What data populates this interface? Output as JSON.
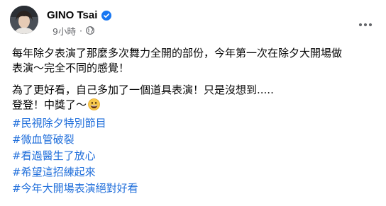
{
  "post": {
    "author": "GINO Tsai",
    "timestamp": "9小時",
    "separator": "·",
    "paragraphs": [
      {
        "lines": [
          "每年除夕表演了那麼多次舞力全開的部份，今年第一次在除夕大開場做",
          "表演～完全不同的感覺！"
        ]
      },
      {
        "lines": [
          "為了更好看，自己多加了一個道具表演！只是沒想到.....",
          "登登！中獎了～"
        ]
      }
    ],
    "hashtags": [
      "#民視除夕特別節目",
      "#微血管破裂",
      "#看過醫生了放心",
      "#希望這招練起來",
      "#今年大開場表演絕對好看"
    ],
    "icons": {
      "verified": "verified-badge-icon",
      "audience": "globe-icon",
      "more": "more-options-icon",
      "emoji": "grinning-face-emoji"
    },
    "colors": {
      "hashtag": "#216fdb",
      "verified": "#1877f2",
      "meta": "#65676b"
    }
  }
}
